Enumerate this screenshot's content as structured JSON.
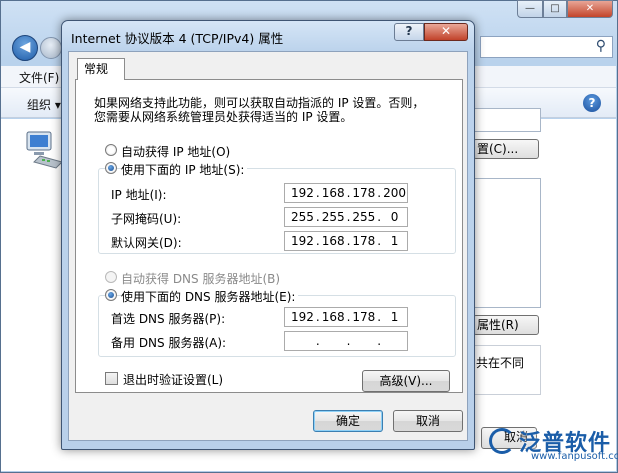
{
  "background_window": {
    "menu_file": "文件(F)",
    "toolbar_organize": "组织 ▾",
    "button_configure": "置(C)...",
    "button_properties": "属性(R)",
    "description_fragment": "共在不同",
    "cancel_label": "取消"
  },
  "watermark": {
    "brand": "泛普软件",
    "url": "www.fanpusoft.com"
  },
  "dialog": {
    "title": "Internet 协议版本 4 (TCP/IPv4) 属性",
    "help_glyph": "?",
    "close_glyph": "✕",
    "tab_general": "常规",
    "intro_line1": "如果网络支持此功能，则可以获取自动指派的 IP 设置。否则，",
    "intro_line2": "您需要从网络系统管理员处获得适当的 IP 设置。",
    "ip_auto_label": "自动获得 IP 地址(O)",
    "ip_manual_label": "使用下面的 IP 地址(S):",
    "ip_address_label": "IP 地址(I):",
    "subnet_mask_label": "子网掩码(U):",
    "gateway_label": "默认网关(D):",
    "ip_address": [
      "192",
      "168",
      "178",
      "200"
    ],
    "subnet_mask": [
      "255",
      "255",
      "255",
      "0"
    ],
    "gateway": [
      "192",
      "168",
      "178",
      "1"
    ],
    "dns_auto_label": "自动获得 DNS 服务器地址(B)",
    "dns_manual_label": "使用下面的 DNS 服务器地址(E):",
    "preferred_dns_label": "首选 DNS 服务器(P):",
    "alternate_dns_label": "备用 DNS 服务器(A):",
    "preferred_dns": [
      "192",
      "168",
      "178",
      "1"
    ],
    "alternate_dns": [
      "",
      "",
      "",
      ""
    ],
    "ip_dot": ".",
    "validate_label": "退出时验证设置(L)",
    "advanced_button": "高级(V)...",
    "ok_button": "确定",
    "cancel_button": "取消"
  }
}
